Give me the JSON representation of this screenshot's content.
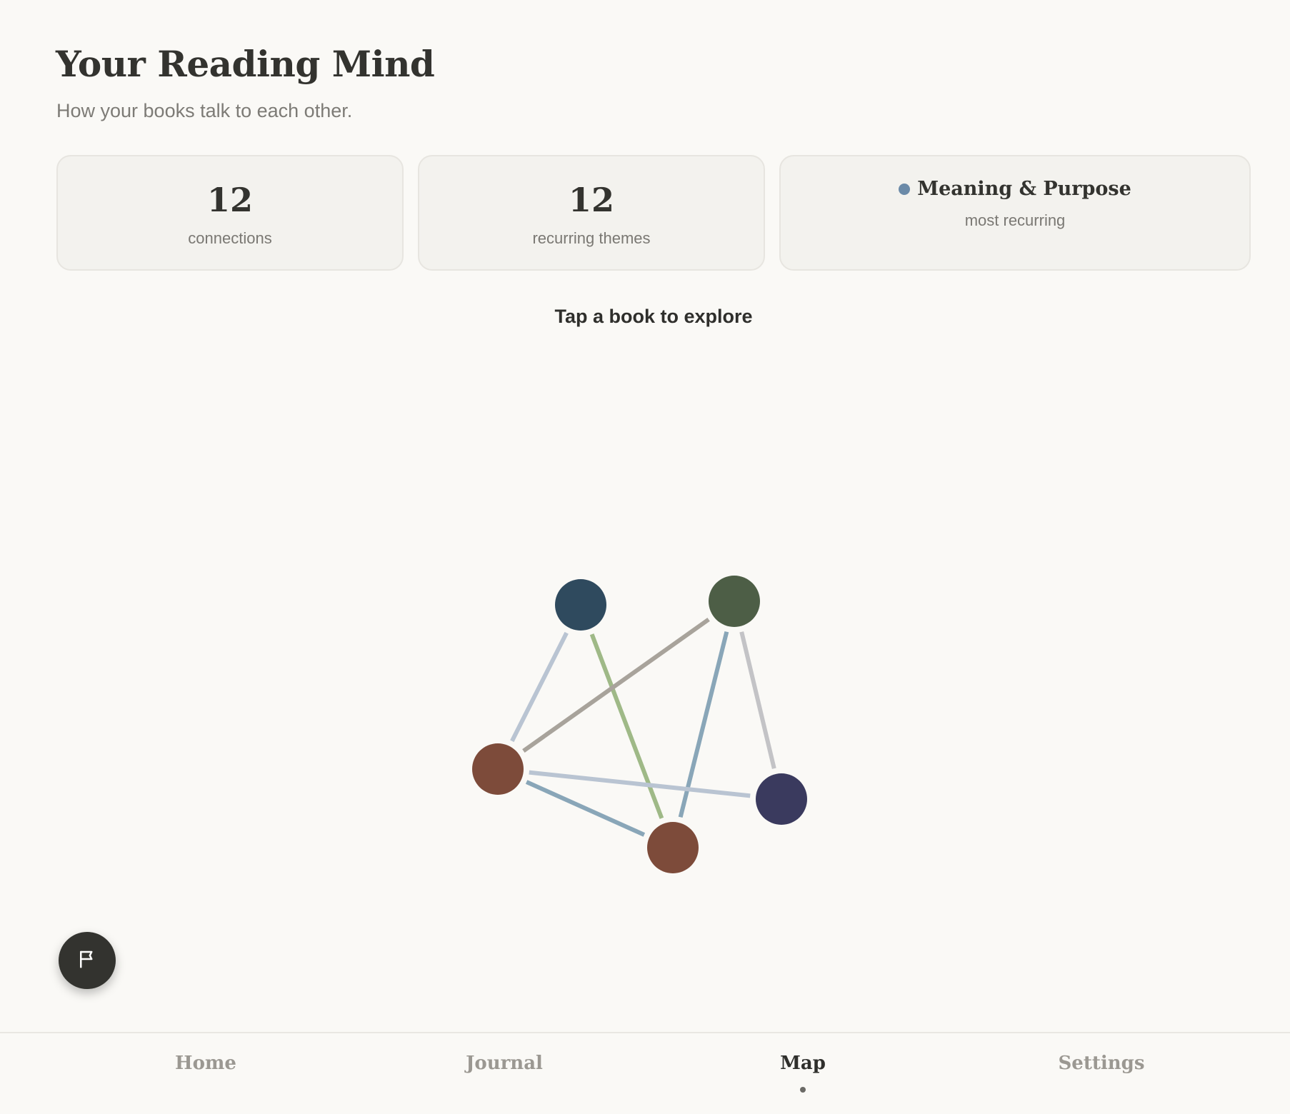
{
  "header": {
    "title": "Your Reading Mind",
    "subtitle": "How your books talk to each other."
  },
  "stats": {
    "connections": {
      "value": "12",
      "label": "connections"
    },
    "themes": {
      "value": "12",
      "label": "recurring themes"
    },
    "top_theme": {
      "name": "Meaning & Purpose",
      "label": "most recurring",
      "color": "#6b8aa8"
    }
  },
  "hint": "Tap a book to explore",
  "graph": {
    "nodes": [
      {
        "id": "book-1",
        "color": "#2f4a5e"
      },
      {
        "id": "book-2",
        "color": "#4d5e46"
      },
      {
        "id": "book-3",
        "color": "#7d4b3a"
      },
      {
        "id": "book-4",
        "color": "#3a3a5e"
      },
      {
        "id": "book-5",
        "color": "#7d4b3a"
      }
    ],
    "edges": [
      {
        "from": "book-1",
        "to": "book-3",
        "color": "#b9c4d2"
      },
      {
        "from": "book-1",
        "to": "book-5",
        "color": "#9fb987"
      },
      {
        "from": "book-2",
        "to": "book-3",
        "color": "#a8a39b"
      },
      {
        "from": "book-2",
        "to": "book-5",
        "color": "#89a6b8"
      },
      {
        "from": "book-2",
        "to": "book-4",
        "color": "#c3c3c6"
      },
      {
        "from": "book-3",
        "to": "book-4",
        "color": "#b9c4d2"
      },
      {
        "from": "book-3",
        "to": "book-5",
        "color": "#89a6b8"
      }
    ]
  },
  "fab": {
    "icon": "flag-icon"
  },
  "nav": {
    "tabs": [
      {
        "label": "Home",
        "active": false
      },
      {
        "label": "Journal",
        "active": false
      },
      {
        "label": "Map",
        "active": true
      },
      {
        "label": "Settings",
        "active": false
      }
    ]
  }
}
